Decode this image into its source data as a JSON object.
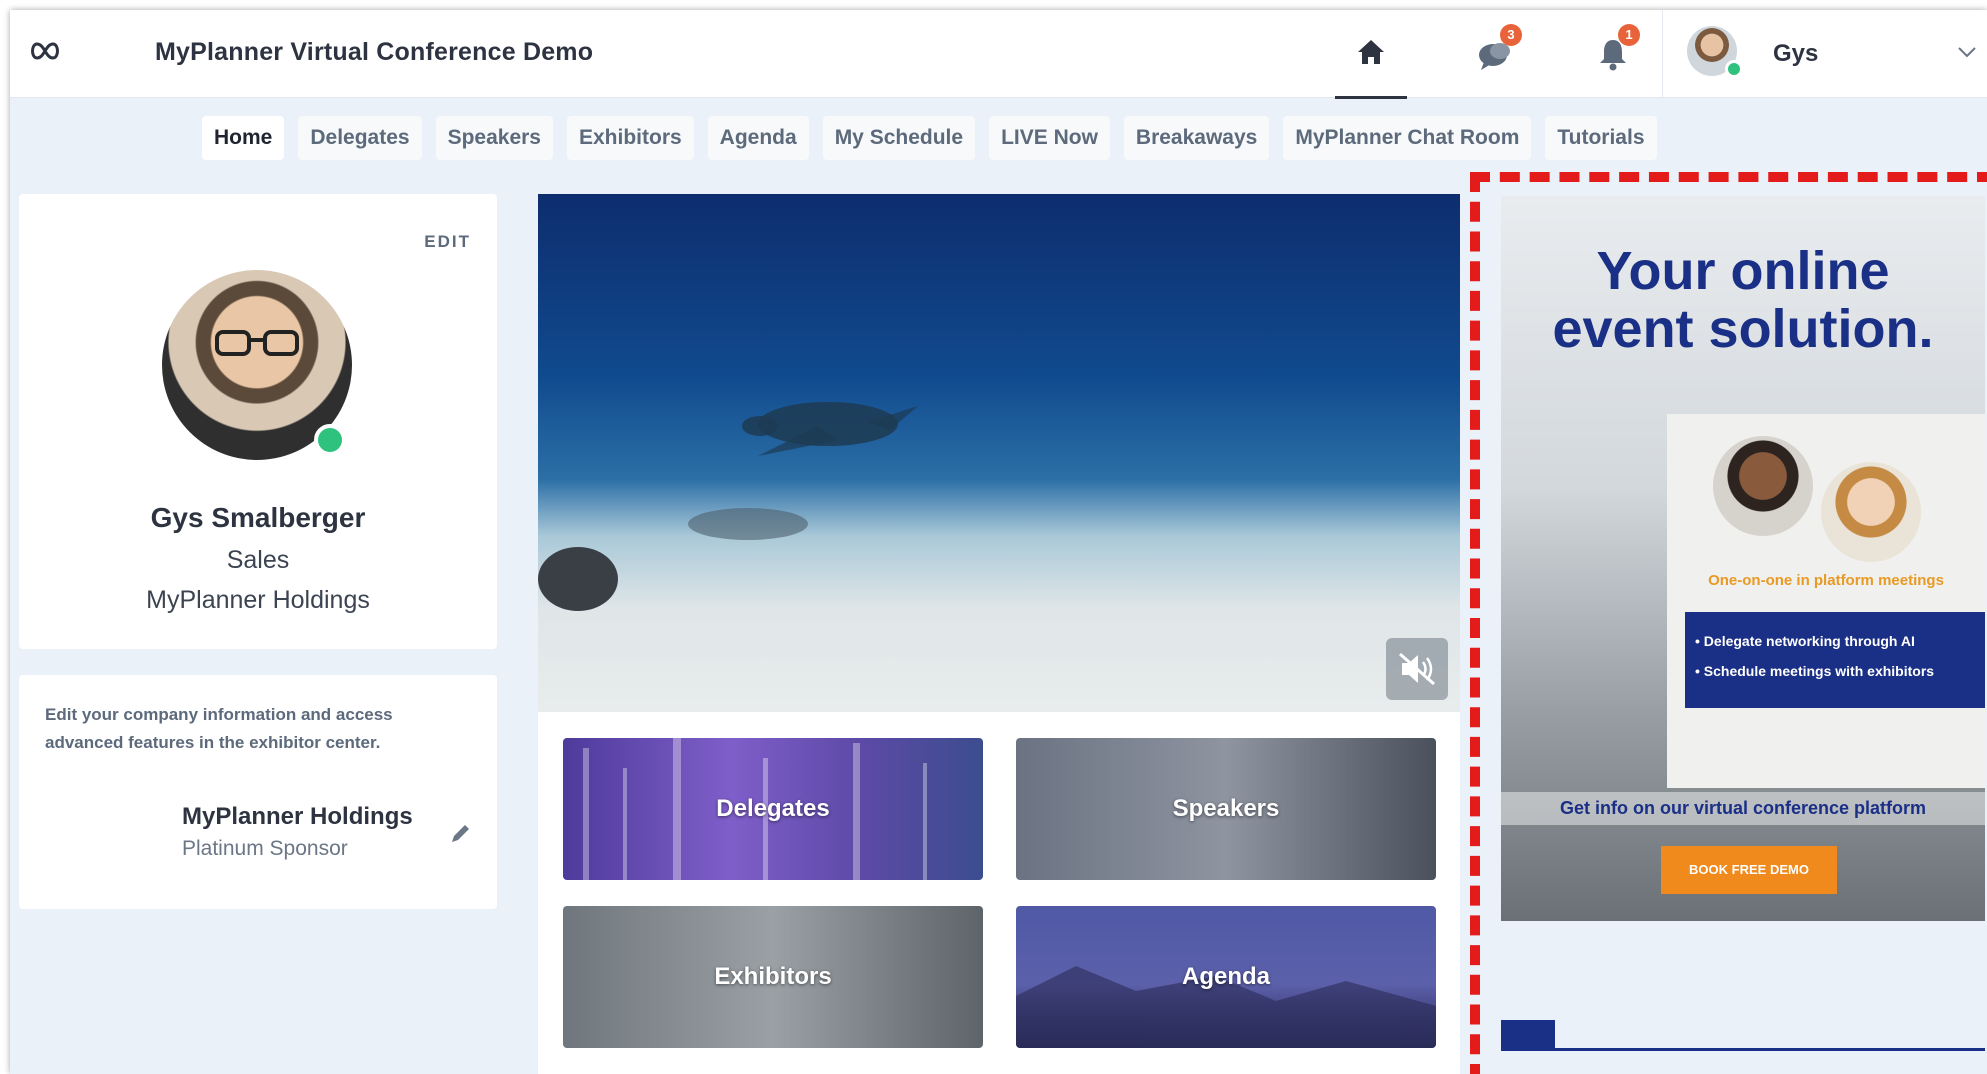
{
  "app": {
    "title": "MyPlanner Virtual Conference Demo"
  },
  "header": {
    "chat_badge": "3",
    "notifications_badge": "1",
    "user_name": "Gys"
  },
  "nav": {
    "items": [
      "Home",
      "Delegates",
      "Speakers",
      "Exhibitors",
      "Agenda",
      "My Schedule",
      "LIVE Now",
      "Breakaways",
      "MyPlanner Chat Room",
      "Tutorials"
    ],
    "active": "Home"
  },
  "profile": {
    "edit_label": "EDIT",
    "name": "Gys Smalberger",
    "role": "Sales",
    "company": "MyPlanner Holdings"
  },
  "company_card": {
    "note": "Edit your company information and access advanced features in the exhibitor center.",
    "name": "MyPlanner Holdings",
    "tier": "Platinum Sponsor"
  },
  "tiles": {
    "delegates": "Delegates",
    "speakers": "Speakers",
    "exhibitors": "Exhibitors",
    "agenda": "Agenda"
  },
  "ad": {
    "headline_line1": "Your online",
    "headline_line2": "event solution.",
    "meetings_caption": "One-on-one in platform meetings",
    "bullet_1": "Delegate networking through AI",
    "bullet_2": "Schedule meetings with exhibitors",
    "info": "Get info on our virtual conference platform",
    "cta": "BOOK FREE DEMO"
  },
  "colors": {
    "accent_online": "#2ec27e",
    "badge": "#e8633a",
    "ad_blue": "#1a2f86",
    "ad_orange": "#f08a1c",
    "highlight_border": "#e31b1b"
  }
}
